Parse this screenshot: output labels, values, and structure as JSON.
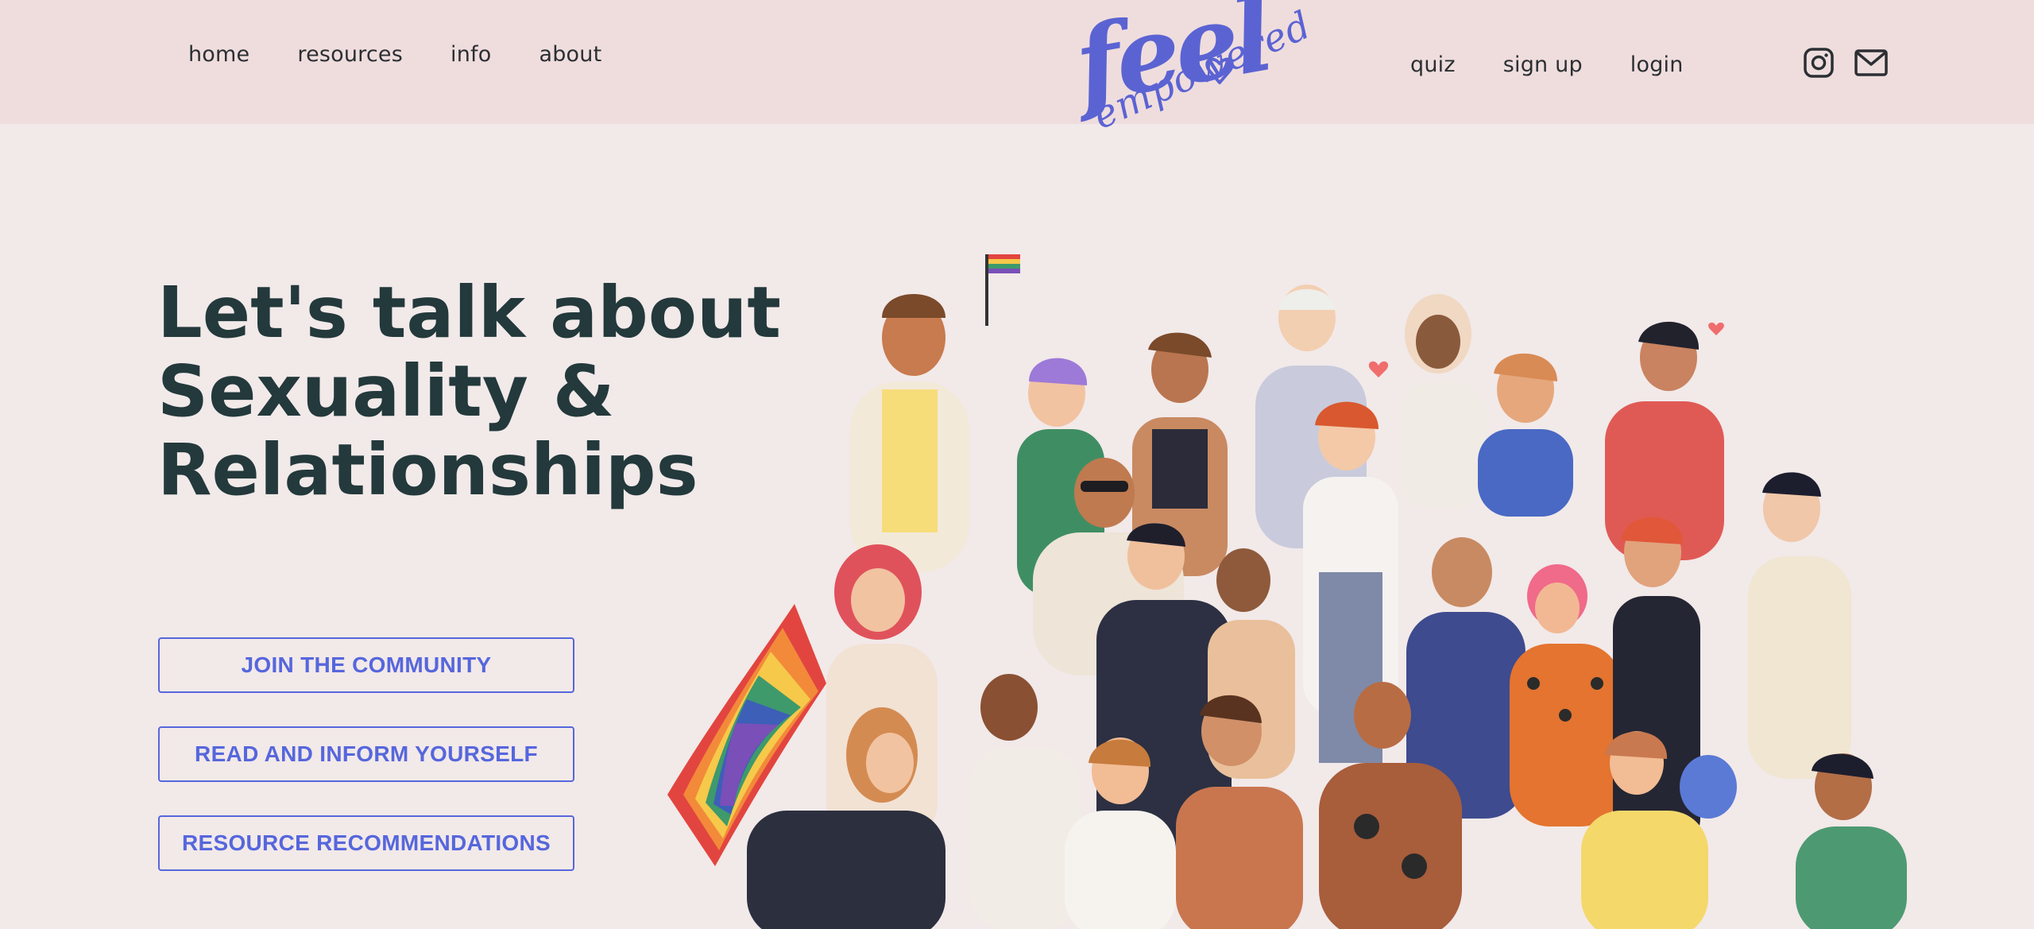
{
  "nav": {
    "left": [
      "home",
      "resources",
      "info",
      "about"
    ],
    "right": [
      "quiz",
      "sign up",
      "login"
    ]
  },
  "social": {
    "instagram_icon": "instagram-icon",
    "mail_icon": "mail-icon"
  },
  "logo": {
    "word1": "feel",
    "word2": "empowered"
  },
  "hero": {
    "title_lines": [
      "Let's talk about",
      "Sexuality &",
      "Relationships"
    ]
  },
  "cta": {
    "join": "JOIN THE COMMUNITY",
    "read": "READ AND INFORM YOURSELF",
    "resources": "RESOURCE RECOMMENDATIONS"
  },
  "colors": {
    "background": "#f2e9e9",
    "topbar": "#efdddd",
    "accent": "#5667dc",
    "title": "#23393b"
  }
}
